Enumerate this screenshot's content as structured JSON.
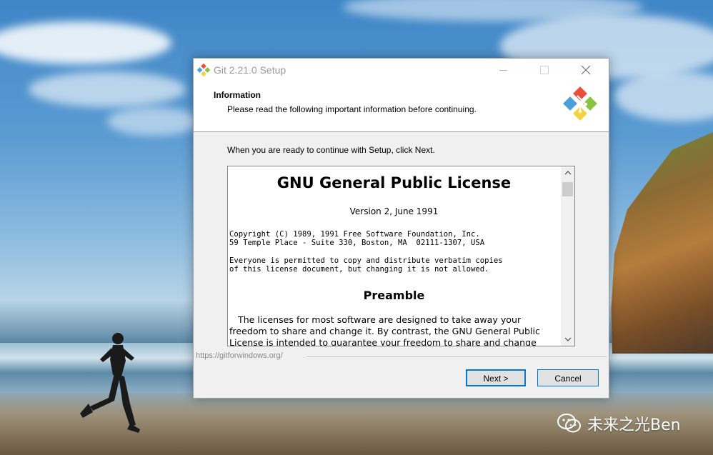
{
  "window": {
    "title": "Git 2.21.0 Setup"
  },
  "header": {
    "title": "Information",
    "subtitle": "Please read the following important information before continuing."
  },
  "intro_text": "When you are ready to continue with Setup, click Next.",
  "license": {
    "heading": "GNU General Public License",
    "version": "Version 2, June 1991",
    "copyright": "Copyright (C) 1989, 1991 Free Software Foundation, Inc.\n59 Temple Place - Suite 330, Boston, MA  02111-1307, USA",
    "permission": "Everyone is permitted to copy and distribute verbatim copies\nof this license document, but changing it is not allowed.",
    "preamble_heading": "Preamble",
    "preamble_text": "The licenses for most software are designed to take away your freedom to share and change it. By contrast, the GNU General Public License is intended to guarantee your freedom to share and change"
  },
  "footer": {
    "url": "https://gitforwindows.org/"
  },
  "buttons": {
    "next": "Next >",
    "cancel": "Cancel"
  },
  "watermark": {
    "text": "未来之光Ben"
  },
  "colors": {
    "accent": "#0078d7",
    "git_red": "#e94f3b",
    "git_green": "#88c341",
    "git_blue": "#4d9fd8",
    "git_yellow": "#f6d33d"
  }
}
